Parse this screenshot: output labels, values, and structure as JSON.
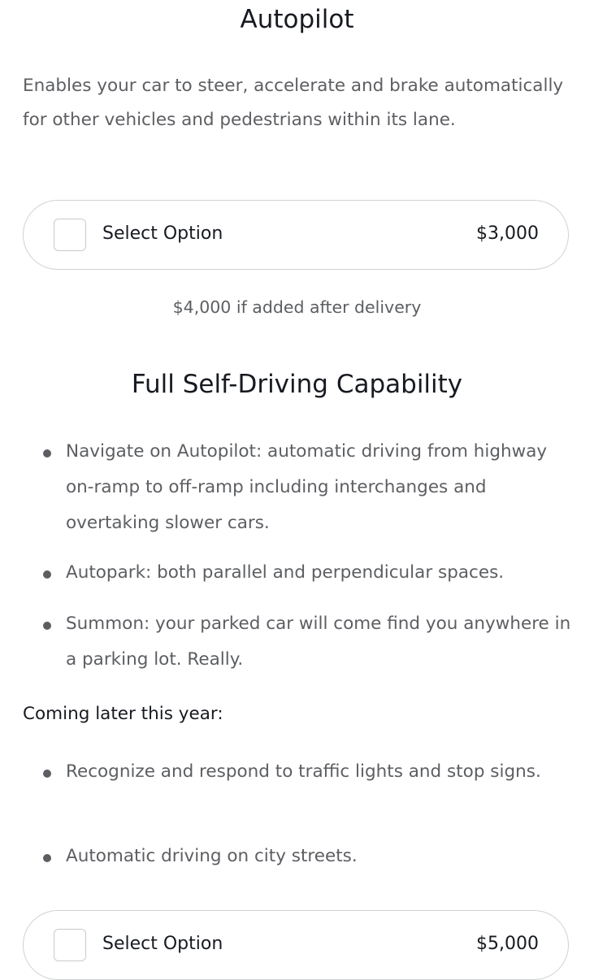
{
  "autopilot": {
    "title": "Autopilot",
    "description": "Enables your car to steer, accelerate and brake automatically for other vehicles and pedestrians within its lane.",
    "option": {
      "label": "Select Option",
      "price": "$3,000",
      "checked": false
    },
    "after_delivery_note": "$4,000 if added after delivery"
  },
  "fsd": {
    "title": "Full Self-Driving Capability",
    "features": [
      "Navigate on Autopilot: automatic driving from highway on-ramp to off-ramp including interchanges and overtaking slower cars.",
      "Autopark: both parallel and perpendicular spaces.",
      "Summon: your parked car will come find you anywhere in a parking lot. Really."
    ],
    "coming_later_heading": "Coming later this year:",
    "coming_later": [
      "Recognize and respond to traffic lights and stop signs.",
      "Automatic driving on city streets."
    ],
    "option": {
      "label": "Select Option",
      "price": "$5,000",
      "checked": false
    }
  },
  "colors": {
    "heading_text": "#171a20",
    "body_text": "#5c5e62",
    "pill_border": "#d0d1d2",
    "background": "#ffffff"
  }
}
